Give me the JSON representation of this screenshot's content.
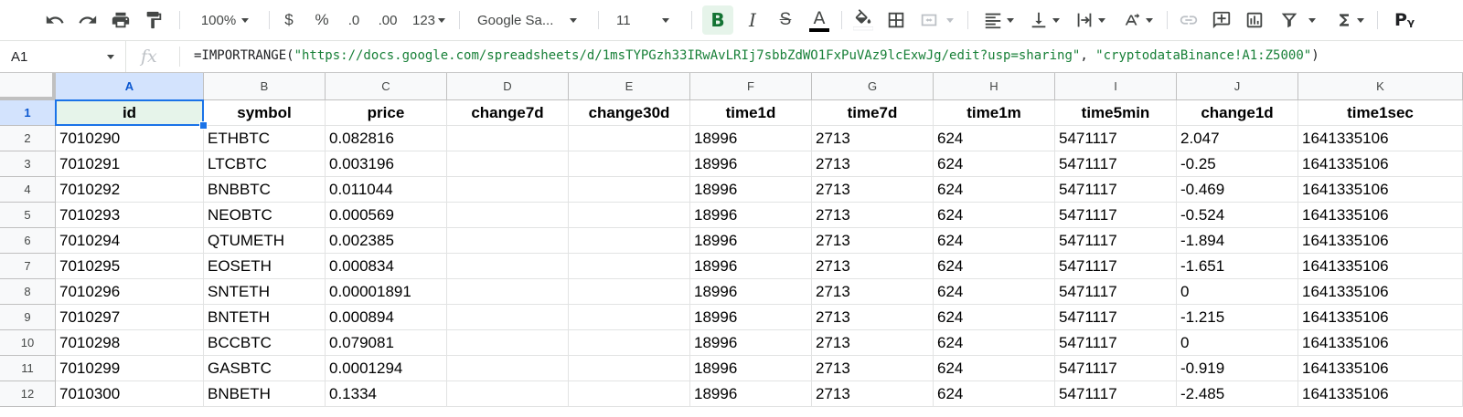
{
  "toolbar": {
    "zoom": "100%",
    "currency": "$",
    "percent": "%",
    "decrease_decimal": ".0",
    "increase_decimal": ".00",
    "more_formats": "123",
    "font_family": "Google Sa...",
    "font_size": "11",
    "bold": "B",
    "italic": "I",
    "strikethrough": "S",
    "text_color": "A",
    "account_badge": "Pᵧ",
    "icons": [
      "undo-icon",
      "redo-icon",
      "print-icon",
      "paint-format-icon",
      "fill-color-icon",
      "borders-icon",
      "merge-cells-icon",
      "horizontal-align-icon",
      "vertical-align-icon",
      "text-wrap-icon",
      "text-rotation-icon",
      "insert-link-icon",
      "insert-comment-icon",
      "insert-chart-icon",
      "filter-icon",
      "functions-icon"
    ]
  },
  "formula_bar": {
    "cell_ref": "A1",
    "fx": "fx",
    "formula_prefix": "=IMPORTRANGE(",
    "formula_url": "\"https://docs.google.com/spreadsheets/d/1msTYPGzh33IRwAvLRIj7sbbZdWO1FxPuVAz9lcExwJg/edit?usp=sharing\"",
    "formula_sep": ", ",
    "formula_range": "\"cryptodataBinance!A1:Z5000\"",
    "formula_suffix": ")"
  },
  "sheet": {
    "selected_cell": "A1",
    "columns": [
      "A",
      "B",
      "C",
      "D",
      "E",
      "F",
      "G",
      "H",
      "I",
      "J",
      "K"
    ],
    "rows": [
      {
        "n": "1",
        "cells": [
          "id",
          "symbol",
          "price",
          "change7d",
          "change30d",
          "time1d",
          "time7d",
          "time1m",
          "time5min",
          "change1d",
          "time1sec"
        ]
      },
      {
        "n": "2",
        "cells": [
          "7010290",
          "ETHBTC",
          "0.082816",
          "",
          "",
          "18996",
          "2713",
          "624",
          "5471117",
          "2.047",
          "1641335106"
        ]
      },
      {
        "n": "3",
        "cells": [
          "7010291",
          "LTCBTC",
          "0.003196",
          "",
          "",
          "18996",
          "2713",
          "624",
          "5471117",
          "-0.25",
          "1641335106"
        ]
      },
      {
        "n": "4",
        "cells": [
          "7010292",
          "BNBBTC",
          "0.011044",
          "",
          "",
          "18996",
          "2713",
          "624",
          "5471117",
          "-0.469",
          "1641335106"
        ]
      },
      {
        "n": "5",
        "cells": [
          "7010293",
          "NEOBTC",
          "0.000569",
          "",
          "",
          "18996",
          "2713",
          "624",
          "5471117",
          "-0.524",
          "1641335106"
        ]
      },
      {
        "n": "6",
        "cells": [
          "7010294",
          "QTUMETH",
          "0.002385",
          "",
          "",
          "18996",
          "2713",
          "624",
          "5471117",
          "-1.894",
          "1641335106"
        ]
      },
      {
        "n": "7",
        "cells": [
          "7010295",
          "EOSETH",
          "0.000834",
          "",
          "",
          "18996",
          "2713",
          "624",
          "5471117",
          "-1.651",
          "1641335106"
        ]
      },
      {
        "n": "8",
        "cells": [
          "7010296",
          "SNTETH",
          "0.00001891",
          "",
          "",
          "18996",
          "2713",
          "624",
          "5471117",
          "0",
          "1641335106"
        ]
      },
      {
        "n": "9",
        "cells": [
          "7010297",
          "BNTETH",
          "0.000894",
          "",
          "",
          "18996",
          "2713",
          "624",
          "5471117",
          "-1.215",
          "1641335106"
        ]
      },
      {
        "n": "10",
        "cells": [
          "7010298",
          "BCCBTC",
          "0.079081",
          "",
          "",
          "18996",
          "2713",
          "624",
          "5471117",
          "0",
          "1641335106"
        ]
      },
      {
        "n": "11",
        "cells": [
          "7010299",
          "GASBTC",
          "0.0001294",
          "",
          "",
          "18996",
          "2713",
          "624",
          "5471117",
          "-0.919",
          "1641335106"
        ]
      },
      {
        "n": "12",
        "cells": [
          "7010300",
          "BNBETH",
          "0.1334",
          "",
          "",
          "18996",
          "2713",
          "624",
          "5471117",
          "-2.485",
          "1641335106"
        ]
      }
    ]
  }
}
